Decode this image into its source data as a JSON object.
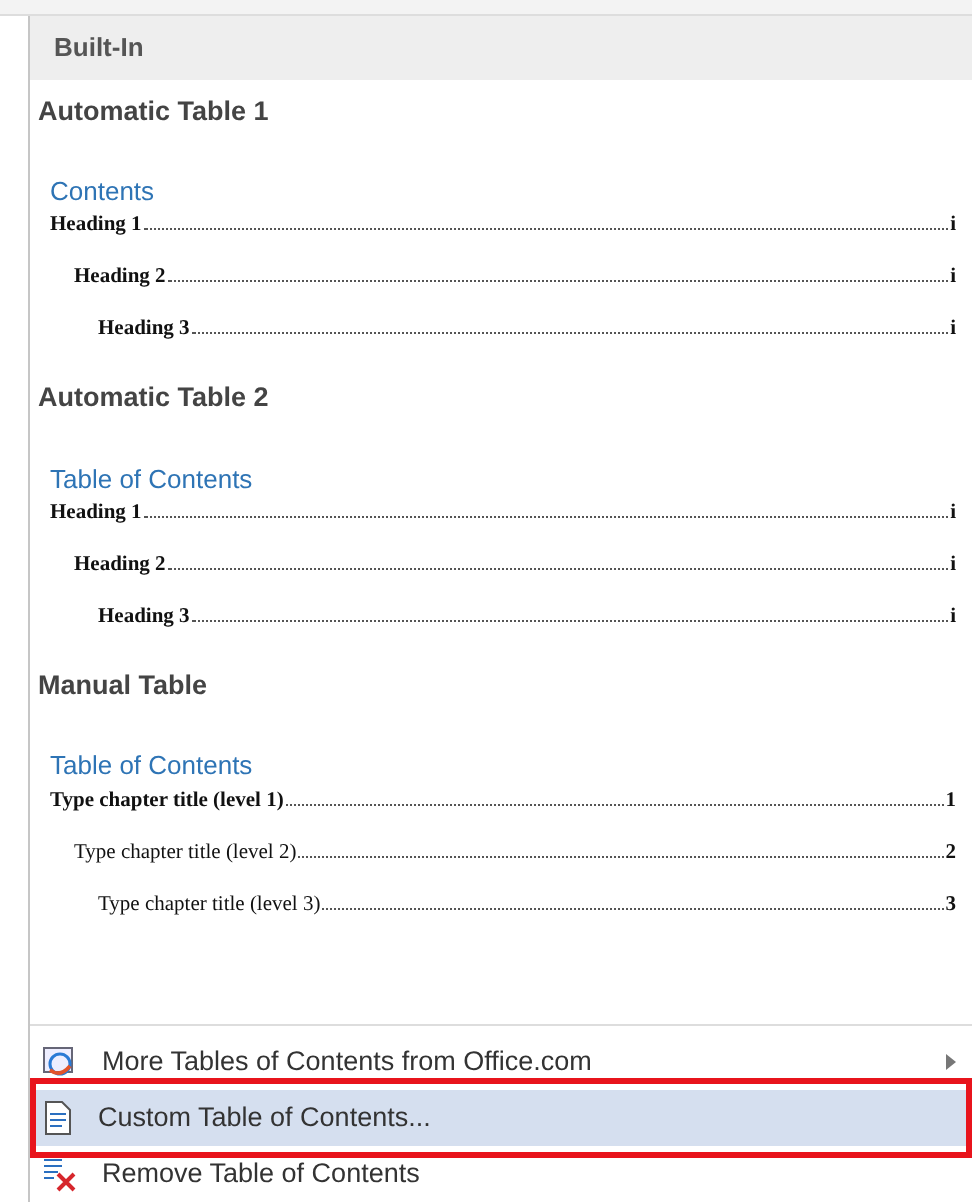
{
  "gallery": {
    "header": "Built-In",
    "sections": [
      {
        "title": "Automatic Table 1",
        "toc_title": "Contents",
        "entries": [
          {
            "text": "Heading 1",
            "page": "i",
            "bold": true,
            "children": [
              {
                "text": "Heading 2",
                "page": "i",
                "bold": true,
                "children": [
                  {
                    "text": "Heading 3",
                    "page": "i",
                    "bold": true
                  }
                ]
              }
            ]
          }
        ]
      },
      {
        "title": "Automatic Table 2",
        "toc_title": "Table of Contents",
        "entries": [
          {
            "text": "Heading 1",
            "page": "i",
            "bold": true,
            "children": [
              {
                "text": "Heading 2",
                "page": "i",
                "bold": true,
                "children": [
                  {
                    "text": "Heading 3",
                    "page": "i",
                    "bold": true
                  }
                ]
              }
            ]
          }
        ]
      },
      {
        "title": "Manual Table",
        "toc_title": "Table of Contents",
        "entries": [
          {
            "text": "Type chapter title (level 1)",
            "page": "1",
            "bold": true,
            "children": [
              {
                "text": "Type chapter title (level 2)",
                "page": "2",
                "bold": false,
                "children": [
                  {
                    "text": "Type chapter title (level 3)",
                    "page": "3",
                    "bold": false
                  }
                ]
              }
            ]
          }
        ]
      }
    ]
  },
  "menu": [
    {
      "kind": "web",
      "label": "More Tables of Contents from Office.com",
      "selected": false,
      "submenu": true,
      "outlined": false
    },
    {
      "kind": "custom",
      "label": "Custom Table of Contents...",
      "selected": true,
      "submenu": false,
      "outlined": true
    },
    {
      "kind": "remove",
      "label": "Remove Table of Contents",
      "selected": false,
      "submenu": false,
      "outlined": false
    }
  ]
}
